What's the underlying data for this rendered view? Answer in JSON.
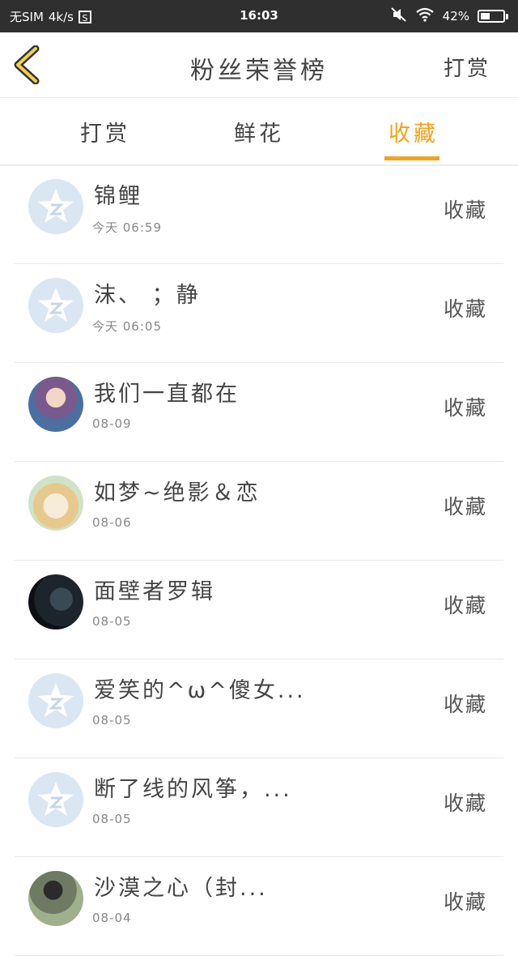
{
  "status_bar": {
    "sim": "无SIM",
    "speed": "4k/s",
    "sim_icon_label": "S",
    "time": "16:03",
    "battery": "42%",
    "battery_level": 0.42,
    "icons": [
      "sim-card-icon",
      "mute-icon",
      "wifi-icon",
      "battery-icon"
    ]
  },
  "header": {
    "back_icon": "chevron-left-icon",
    "title": "粉丝荣誉榜",
    "action": "打赏"
  },
  "tabs": [
    {
      "label": "打赏",
      "active": false
    },
    {
      "label": "鲜花",
      "active": false
    },
    {
      "label": "收藏",
      "active": true
    }
  ],
  "colors": {
    "accent": "#f5a21b",
    "status_bar": "#2f2f2f",
    "default_avatar": "#dbe6f3"
  },
  "fans": [
    {
      "name": "锦鲤",
      "time": "今天 06:59",
      "action": "收藏",
      "avatar": "default-avatar-icon"
    },
    {
      "name": "沫、 ；静",
      "time": "今天 06:05",
      "action": "收藏",
      "avatar": "default-avatar-icon"
    },
    {
      "name": "我们一直都在",
      "time": "08-09",
      "action": "收藏",
      "avatar": "user-photo"
    },
    {
      "name": "如梦~绝影＆恋",
      "time": "08-06",
      "action": "收藏",
      "avatar": "user-photo"
    },
    {
      "name": "面壁者罗辑",
      "time": "08-05",
      "action": "收藏",
      "avatar": "user-photo"
    },
    {
      "name": "爱笑的^ω^傻女...",
      "time": "08-05",
      "action": "收藏",
      "avatar": "default-avatar-icon"
    },
    {
      "name": "断了线的风筝，...",
      "time": "08-05",
      "action": "收藏",
      "avatar": "default-avatar-icon"
    },
    {
      "name": "沙漠之心（封...",
      "time": "08-04",
      "action": "收藏",
      "avatar": "user-photo"
    }
  ]
}
